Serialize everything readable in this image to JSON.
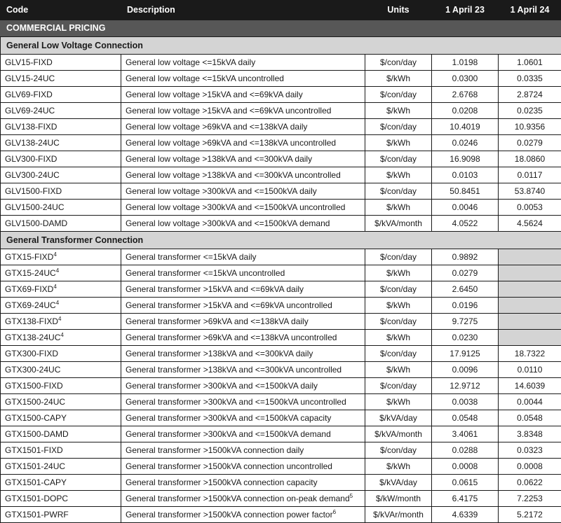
{
  "table": {
    "columns": [
      {
        "key": "code",
        "label": "Code",
        "align": "left"
      },
      {
        "key": "desc",
        "label": "Description",
        "align": "left"
      },
      {
        "key": "units",
        "label": "Units",
        "align": "center"
      },
      {
        "key": "p23",
        "label": "1 April 23",
        "align": "center"
      },
      {
        "key": "p24",
        "label": "1 April 24",
        "align": "center"
      }
    ],
    "banner": "COMMERCIAL PRICING",
    "colors": {
      "header_bg": "#1a1a1a",
      "header_text": "#ffffff",
      "banner_bg": "#575757",
      "banner_text": "#ffffff",
      "section_bg": "#d4d4d4",
      "section_text": "#1a1a1a",
      "blank_cell_bg": "#d4d4d4",
      "row_bg": "#ffffff",
      "row_text": "#1a1a1a",
      "border": "#1a1a1a"
    },
    "sections": [
      {
        "title": "General Low Voltage Connection",
        "rows": [
          {
            "code": "GLV15-FIXD",
            "code_sup": "",
            "desc": "General low voltage <=15kVA daily",
            "desc_sup": "",
            "units": "$/con/day",
            "p23": "1.0198",
            "p24": "1.0601"
          },
          {
            "code": "GLV15-24UC",
            "code_sup": "",
            "desc": "General low voltage <=15kVA uncontrolled",
            "desc_sup": "",
            "units": "$/kWh",
            "p23": "0.0300",
            "p24": "0.0335"
          },
          {
            "code": "GLV69-FIXD",
            "code_sup": "",
            "desc": "General low voltage >15kVA and <=69kVA daily",
            "desc_sup": "",
            "units": "$/con/day",
            "p23": "2.6768",
            "p24": "2.8724"
          },
          {
            "code": "GLV69-24UC",
            "code_sup": "",
            "desc": "General low voltage >15kVA and <=69kVA uncontrolled",
            "desc_sup": "",
            "units": "$/kWh",
            "p23": "0.0208",
            "p24": "0.0235"
          },
          {
            "code": "GLV138-FIXD",
            "code_sup": "",
            "desc": "General low voltage >69kVA and <=138kVA daily",
            "desc_sup": "",
            "units": "$/con/day",
            "p23": "10.4019",
            "p24": "10.9356"
          },
          {
            "code": "GLV138-24UC",
            "code_sup": "",
            "desc": "General low voltage >69kVA and <=138kVA uncontrolled",
            "desc_sup": "",
            "units": "$/kWh",
            "p23": "0.0246",
            "p24": "0.0279"
          },
          {
            "code": "GLV300-FIXD",
            "code_sup": "",
            "desc": "General low voltage >138kVA and <=300kVA daily",
            "desc_sup": "",
            "units": "$/con/day",
            "p23": "16.9098",
            "p24": "18.0860"
          },
          {
            "code": "GLV300-24UC",
            "code_sup": "",
            "desc": "General low voltage >138kVA and <=300kVA uncontrolled",
            "desc_sup": "",
            "units": "$/kWh",
            "p23": "0.0103",
            "p24": "0.0117"
          },
          {
            "code": "GLV1500-FIXD",
            "code_sup": "",
            "desc": "General low voltage >300kVA and <=1500kVA daily",
            "desc_sup": "",
            "units": "$/con/day",
            "p23": "50.8451",
            "p24": "53.8740"
          },
          {
            "code": "GLV1500-24UC",
            "code_sup": "",
            "desc": "General low voltage >300kVA and <=1500kVA uncontrolled",
            "desc_sup": "",
            "units": "$/kWh",
            "p23": "0.0046",
            "p24": "0.0053"
          },
          {
            "code": "GLV1500-DAMD",
            "code_sup": "",
            "desc": "General low voltage >300kVA and <=1500kVA demand",
            "desc_sup": "",
            "units": "$/kVA/month",
            "p23": "4.0522",
            "p24": "4.5624"
          }
        ]
      },
      {
        "title": "General Transformer Connection",
        "rows": [
          {
            "code": "GTX15-FIXD",
            "code_sup": "4",
            "desc": "General transformer <=15kVA daily",
            "desc_sup": "",
            "units": "$/con/day",
            "p23": "0.9892",
            "p24": ""
          },
          {
            "code": "GTX15-24UC",
            "code_sup": "4",
            "desc": "General transformer <=15kVA uncontrolled",
            "desc_sup": "",
            "units": "$/kWh",
            "p23": "0.0279",
            "p24": ""
          },
          {
            "code": "GTX69-FIXD",
            "code_sup": "4",
            "desc": "General transformer >15kVA and <=69kVA daily",
            "desc_sup": "",
            "units": "$/con/day",
            "p23": "2.6450",
            "p24": ""
          },
          {
            "code": "GTX69-24UC",
            "code_sup": "4",
            "desc": "General transformer >15kVA and <=69kVA uncontrolled",
            "desc_sup": "",
            "units": "$/kWh",
            "p23": "0.0196",
            "p24": ""
          },
          {
            "code": "GTX138-FIXD",
            "code_sup": "4",
            "desc": "General transformer >69kVA and <=138kVA daily",
            "desc_sup": "",
            "units": "$/con/day",
            "p23": "9.7275",
            "p24": ""
          },
          {
            "code": "GTX138-24UC",
            "code_sup": "4",
            "desc": "General transformer >69kVA and <=138kVA uncontrolled",
            "desc_sup": "",
            "units": "$/kWh",
            "p23": "0.0230",
            "p24": ""
          },
          {
            "code": "GTX300-FIXD",
            "code_sup": "",
            "desc": "General transformer >138kVA and <=300kVA daily",
            "desc_sup": "",
            "units": "$/con/day",
            "p23": "17.9125",
            "p24": "18.7322"
          },
          {
            "code": "GTX300-24UC",
            "code_sup": "",
            "desc": "General transformer >138kVA and <=300kVA uncontrolled",
            "desc_sup": "",
            "units": "$/kWh",
            "p23": "0.0096",
            "p24": "0.0110"
          },
          {
            "code": "GTX1500-FIXD",
            "code_sup": "",
            "desc": "General transformer >300kVA and <=1500kVA daily",
            "desc_sup": "",
            "units": "$/con/day",
            "p23": "12.9712",
            "p24": "14.6039"
          },
          {
            "code": "GTX1500-24UC",
            "code_sup": "",
            "desc": "General transformer >300kVA and <=1500kVA uncontrolled",
            "desc_sup": "",
            "units": "$/kWh",
            "p23": "0.0038",
            "p24": "0.0044"
          },
          {
            "code": "GTX1500-CAPY",
            "code_sup": "",
            "desc": "General transformer >300kVA and <=1500kVA capacity",
            "desc_sup": "",
            "units": "$/kVA/day",
            "p23": "0.0548",
            "p24": "0.0548"
          },
          {
            "code": "GTX1500-DAMD",
            "code_sup": "",
            "desc": "General transformer >300kVA and <=1500kVA demand",
            "desc_sup": "",
            "units": "$/kVA/month",
            "p23": "3.4061",
            "p24": "3.8348"
          },
          {
            "code": "GTX1501-FIXD",
            "code_sup": "",
            "desc": "General transformer >1500kVA connection daily",
            "desc_sup": "",
            "units": "$/con/day",
            "p23": "0.0288",
            "p24": "0.0323"
          },
          {
            "code": "GTX1501-24UC",
            "code_sup": "",
            "desc": "General transformer >1500kVA connection uncontrolled",
            "desc_sup": "",
            "units": "$/kWh",
            "p23": "0.0008",
            "p24": "0.0008"
          },
          {
            "code": "GTX1501-CAPY",
            "code_sup": "",
            "desc": "General transformer >1500kVA connection capacity",
            "desc_sup": "",
            "units": "$/kVA/day",
            "p23": "0.0615",
            "p24": "0.0622"
          },
          {
            "code": "GTX1501-DOPC",
            "code_sup": "",
            "desc": "General transformer >1500kVA connection on-peak demand",
            "desc_sup": "5",
            "units": "$/kW/month",
            "p23": "6.4175",
            "p24": "7.2253"
          },
          {
            "code": "GTX1501-PWRF",
            "code_sup": "",
            "desc": "General transformer >1500kVA connection power factor",
            "desc_sup": "6",
            "units": "$/kVAr/month",
            "p23": "4.6339",
            "p24": "5.2172"
          }
        ]
      }
    ]
  }
}
